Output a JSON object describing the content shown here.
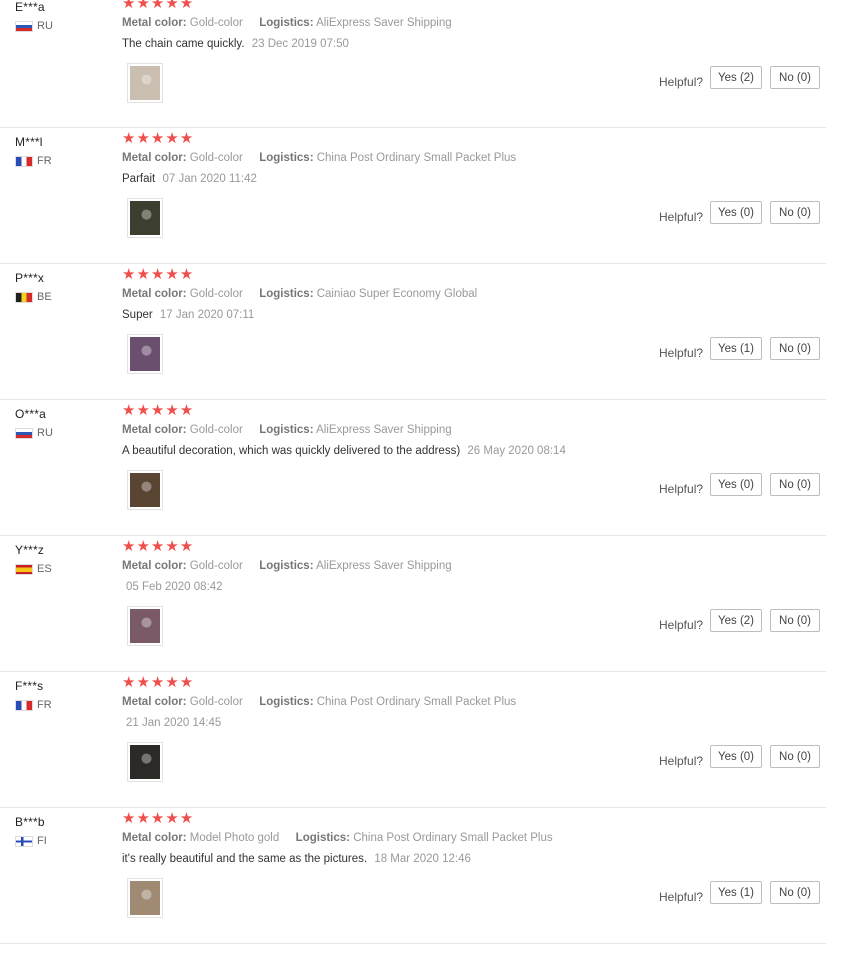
{
  "labels": {
    "metal_color": "Metal color:",
    "logistics": "Logistics:",
    "helpful": "Helpful?"
  },
  "reviews": [
    {
      "user": "E***a",
      "country": "RU",
      "flag": "ru",
      "stars": "★★★★★",
      "metal_color": "Gold-color",
      "logistics": "AliExpress Saver Shipping",
      "text": "The chain came quickly.",
      "date": "23 Dec 2019 07:50",
      "photo_icon": "review-photo-necklace",
      "photo_color": "#c9beb0",
      "yes": "Yes (2)",
      "no": "No (0)"
    },
    {
      "user": "M***l",
      "country": "FR",
      "flag": "fr",
      "stars": "★★★★★",
      "metal_color": "Gold-color",
      "logistics": "China Post Ordinary Small Packet Plus",
      "text": "Parfait",
      "date": "07 Jan 2020 11:42",
      "photo_icon": "review-photo-package",
      "photo_color": "#3c3f2f",
      "yes": "Yes (0)",
      "no": "No (0)"
    },
    {
      "user": "P***x",
      "country": "BE",
      "flag": "be",
      "stars": "★★★★★",
      "metal_color": "Gold-color",
      "logistics": "Cainiao Super Economy Global",
      "text": "Super",
      "date": "17 Jan 2020 07:11",
      "photo_icon": "review-photo-portrait",
      "photo_color": "#6b4f6e",
      "yes": "Yes (1)",
      "no": "No (0)"
    },
    {
      "user": "O***a",
      "country": "RU",
      "flag": "ru",
      "stars": "★★★★★",
      "metal_color": "Gold-color",
      "logistics": "AliExpress Saver Shipping",
      "text": "A beautiful decoration, which was quickly delivered to the address)",
      "date": "26 May 2020 08:14",
      "photo_icon": "review-photo-mirror-selfie",
      "photo_color": "#5a4533",
      "yes": "Yes (0)",
      "no": "No (0)"
    },
    {
      "user": "Y***z",
      "country": "ES",
      "flag": "es",
      "stars": "★★★★★",
      "metal_color": "Gold-color",
      "logistics": "AliExpress Saver Shipping",
      "text": "",
      "date": "05 Feb 2020 08:42",
      "photo_icon": "review-photo-selfie",
      "photo_color": "#7a5a66",
      "yes": "Yes (2)",
      "no": "No (0)"
    },
    {
      "user": "F***s",
      "country": "FR",
      "flag": "fr",
      "stars": "★★★★★",
      "metal_color": "Gold-color",
      "logistics": "China Post Ordinary Small Packet Plus",
      "text": "",
      "date": "21 Jan 2020 14:45",
      "photo_icon": "review-photo-chain",
      "photo_color": "#2b2a26",
      "yes": "Yes (0)",
      "no": "No (0)"
    },
    {
      "user": "B***b",
      "country": "FI",
      "flag": "fi",
      "stars": "★★★★★",
      "metal_color": "Model Photo gold",
      "logistics": "China Post Ordinary Small Packet Plus",
      "text": "it's really beautiful and the same as the pictures.",
      "date": "18 Mar 2020 12:46",
      "photo_icon": "review-photo-woman",
      "photo_color": "#a08a74",
      "yes": "Yes (1)",
      "no": "No (0)"
    }
  ]
}
